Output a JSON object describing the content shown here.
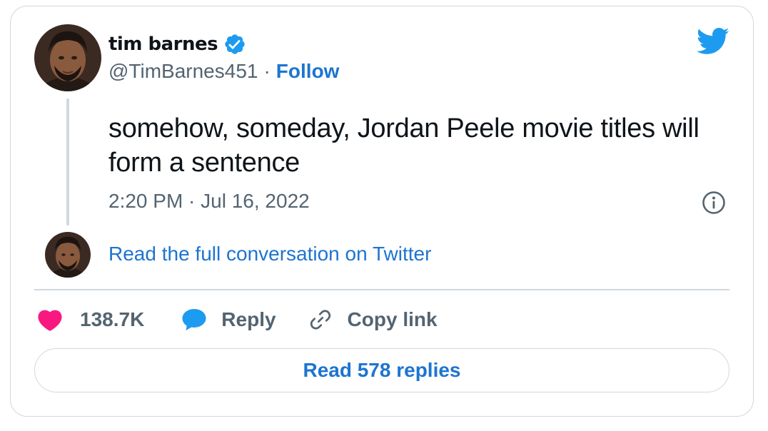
{
  "author": {
    "name": "tim barnes",
    "handle": "@TimBarnes451",
    "separator": "·",
    "follow_label": "Follow",
    "avatar_icon": "user-avatar"
  },
  "tweet": {
    "text": "somehow, someday, Jordan Peele movie titles will form a sentence",
    "timestamp": "2:20 PM · Jul 16, 2022"
  },
  "thread": {
    "read_conversation_label": "Read the full conversation on Twitter"
  },
  "actions": {
    "likes_count": "138.7K",
    "reply_label": "Reply",
    "copy_link_label": "Copy link",
    "read_replies_label": "Read 578 replies"
  },
  "icons": {
    "brand": "twitter-bird-icon",
    "verified": "verified-badge-icon",
    "info": "info-icon",
    "like": "heart-icon",
    "reply": "speech-bubble-icon",
    "copy": "link-icon"
  },
  "colors": {
    "brand_blue": "#1d9bf0",
    "link_blue": "#1d74d0",
    "like_pink": "#f91880",
    "text_primary": "#0f1419",
    "text_secondary": "#536471",
    "border": "#cfd9de"
  }
}
